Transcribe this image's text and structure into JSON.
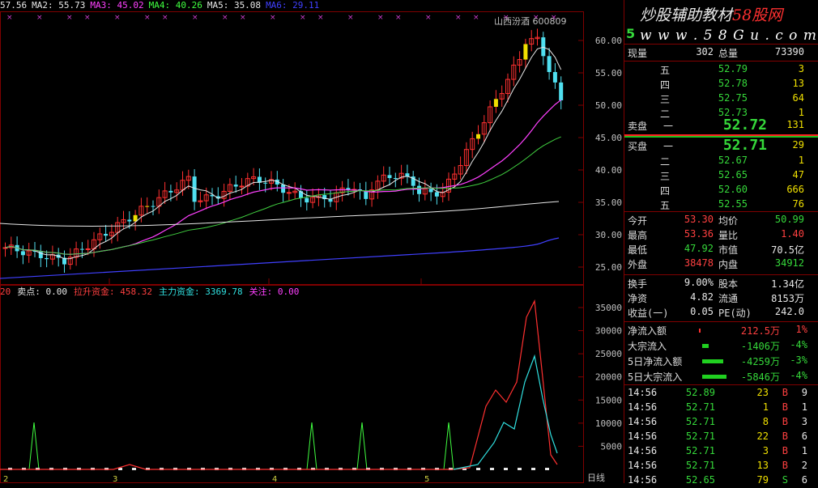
{
  "ma_legend": [
    {
      "label": "57.56",
      "color": "#e8e8e8"
    },
    {
      "label": "MA2: 55.73",
      "color": "#e8e8e8"
    },
    {
      "label": "MA3: 45.02",
      "color": "#ff40ff"
    },
    {
      "label": "MA4: 40.26",
      "color": "#40ff40"
    },
    {
      "label": "MA5: 35.08",
      "color": "#e8e8e8"
    },
    {
      "label": "MA6: 29.11",
      "color": "#4040ff"
    }
  ],
  "stock_tag": "山西汾酒 600809",
  "indicator_legend": [
    {
      "label": "20",
      "color": "#ff4040"
    },
    {
      "label": "卖点: 0.00",
      "color": "#e8e8e8"
    },
    {
      "label": "拉升资金: 458.32",
      "color": "#ff4040"
    },
    {
      "label": "主力资金: 3369.78",
      "color": "#30e0e0"
    },
    {
      "label": "关注: 0.00",
      "color": "#ff40ff"
    }
  ],
  "price_axis": [
    "60.00",
    "55.00",
    "50.00",
    "45.00",
    "40.00",
    "35.00",
    "30.00",
    "25.00"
  ],
  "vol_axis": [
    "35000",
    "30000",
    "25000",
    "20000",
    "15000",
    "10000",
    "5000"
  ],
  "x_marks": [
    "2",
    "3",
    "4",
    "5"
  ],
  "period_label": "日线",
  "brand": {
    "line1": "炒股辅助教材",
    "line1_red": "58股网",
    "line2": "w w w . 5 8 G u . c o m",
    "left_digit": "5"
  },
  "summary": {
    "now_label": "现量",
    "now_val": "302",
    "total_label": "总量",
    "total_val": "73390"
  },
  "asks": [
    {
      "label": "五",
      "price": "52.79",
      "vol": "3"
    },
    {
      "label": "四",
      "price": "52.78",
      "vol": "13"
    },
    {
      "label": "三",
      "price": "52.75",
      "vol": "64"
    },
    {
      "label": "二",
      "price": "52.73",
      "vol": "1"
    },
    {
      "label": "一",
      "price": "52.72",
      "vol": "131"
    }
  ],
  "sell_label": "卖盘",
  "buy_label": "买盘",
  "bids": [
    {
      "label": "一",
      "price": "52.71",
      "vol": "29"
    },
    {
      "label": "二",
      "price": "52.67",
      "vol": "1"
    },
    {
      "label": "三",
      "price": "52.65",
      "vol": "47"
    },
    {
      "label": "四",
      "price": "52.60",
      "vol": "666"
    },
    {
      "label": "五",
      "price": "52.55",
      "vol": "76"
    }
  ],
  "stats": [
    {
      "l1": "今开",
      "v1": "53.30",
      "c1": "red",
      "l2": "均价",
      "v2": "50.99",
      "c2": "green"
    },
    {
      "l1": "最高",
      "v1": "53.36",
      "c1": "red",
      "l2": "量比",
      "v2": "1.40",
      "c2": "red"
    },
    {
      "l1": "最低",
      "v1": "47.92",
      "c1": "green",
      "l2": "市值",
      "v2": "70.5亿",
      "c2": "white"
    },
    {
      "l1": "外盘",
      "v1": "38478",
      "c1": "red",
      "l2": "内盘",
      "v2": "34912",
      "c2": "green"
    },
    {
      "l1": "换手",
      "v1": "9.00%",
      "c1": "white",
      "l2": "股本",
      "v2": "1.34亿",
      "c2": "white"
    },
    {
      "l1": "净资",
      "v1": "4.82",
      "c1": "white",
      "l2": "流通",
      "v2": "8153万",
      "c2": "white"
    },
    {
      "l1": "收益(一)",
      "v1": "0.05",
      "c1": "white",
      "l2": "PE(动)",
      "v2": "242.0",
      "c2": "white"
    }
  ],
  "flows": [
    {
      "label": "净流入额",
      "val": "212.5万",
      "pct": "1%",
      "color": "red",
      "bar": 2
    },
    {
      "label": "大宗流入",
      "val": "-1406万",
      "pct": "-4%",
      "color": "green",
      "bar": 8
    },
    {
      "label": "5日净流入额",
      "val": "-4259万",
      "pct": "-3%",
      "color": "green",
      "bar": 26
    },
    {
      "label": "5日大宗流入",
      "val": "-5846万",
      "pct": "-4%",
      "color": "green",
      "bar": 30
    }
  ],
  "ticks": [
    {
      "time": "14:56",
      "price": "52.89",
      "vol": "23",
      "side": "B",
      "n": "9"
    },
    {
      "time": "14:56",
      "price": "52.71",
      "vol": "1",
      "side": "B",
      "n": "1"
    },
    {
      "time": "14:56",
      "price": "52.71",
      "vol": "8",
      "side": "B",
      "n": "3"
    },
    {
      "time": "14:56",
      "price": "52.71",
      "vol": "22",
      "side": "B",
      "n": "6"
    },
    {
      "time": "14:56",
      "price": "52.71",
      "vol": "3",
      "side": "B",
      "n": "1"
    },
    {
      "time": "14:56",
      "price": "52.71",
      "vol": "13",
      "side": "B",
      "n": "2"
    },
    {
      "time": "14:56",
      "price": "52.65",
      "vol": "79",
      "side": "S",
      "n": "6"
    }
  ]
}
